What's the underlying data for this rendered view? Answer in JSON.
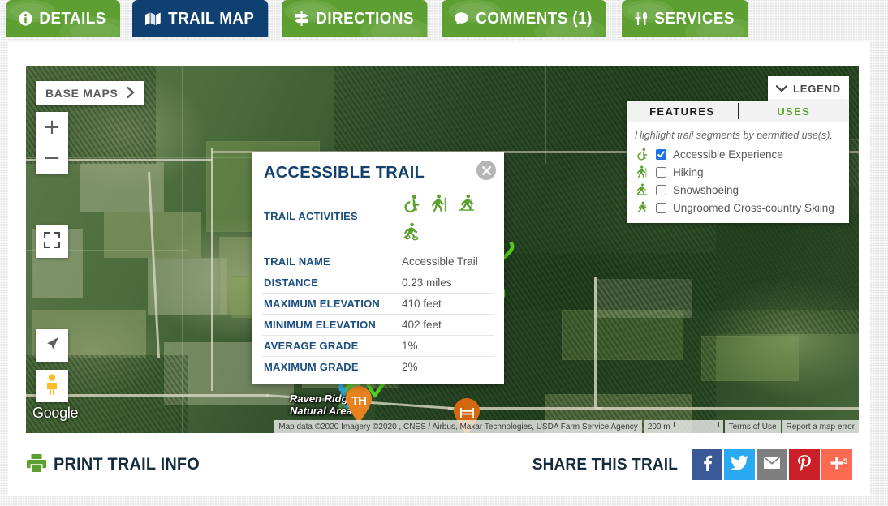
{
  "tabs": [
    {
      "label": "DETAILS",
      "icon": "info-icon",
      "active": false
    },
    {
      "label": "TRAIL MAP",
      "icon": "map-icon",
      "active": true
    },
    {
      "label": "DIRECTIONS",
      "icon": "signpost-icon",
      "active": false
    },
    {
      "label": "COMMENTS (1)",
      "icon": "comment-icon",
      "active": false
    },
    {
      "label": "SERVICES",
      "icon": "utensils-icon",
      "active": false
    }
  ],
  "map": {
    "base_maps_label": "BASE MAPS",
    "zoom_in_label": "+",
    "zoom_out_label": "−",
    "fullscreen_icon": "fullscreen-icon",
    "locate_icon": "navigation-arrow-icon",
    "pegman_icon": "street-view-pegman-icon",
    "google_logo": "Google",
    "place_label": "Raven Ridge\nNatural Area",
    "markers": [
      {
        "name": "trailhead-marker",
        "glyph": "TH",
        "color": "#e8821e"
      },
      {
        "name": "picnic-table-marker",
        "glyph": "picnic-table-icon",
        "color": "#8cc152"
      },
      {
        "name": "bench-marker",
        "glyph": "bench-icon",
        "color": "#d2690f"
      }
    ],
    "attribution": {
      "map_data": "Map data ©2020 Imagery ©2020 , CNES / Airbus, Maxar Technologies, USDA Farm Service Agency",
      "scale": "200 m",
      "terms": "Terms of Use",
      "report": "Report a map error"
    }
  },
  "info_popup": {
    "title": "ACCESSIBLE TRAIL",
    "close_icon": "close-icon",
    "activities_label": "TRAIL ACTIVITIES",
    "activities": [
      "wheelchair-accessible-icon",
      "hiking-icon",
      "cross-country-skiing-icon",
      "snowshoeing-icon"
    ],
    "rows": [
      {
        "key": "TRAIL NAME",
        "value": "Accessible Trail"
      },
      {
        "key": "DISTANCE",
        "value": "0.23 miles"
      },
      {
        "key": "MAXIMUM ELEVATION",
        "value": "410 feet"
      },
      {
        "key": "MINIMUM ELEVATION",
        "value": "402 feet"
      },
      {
        "key": "AVERAGE GRADE",
        "value": "1%"
      },
      {
        "key": "MAXIMUM GRADE",
        "value": "2%"
      }
    ]
  },
  "legend": {
    "header_label": "LEGEND",
    "chevron_icon": "chevron-down-icon",
    "tabs": [
      {
        "label": "FEATURES",
        "active": false
      },
      {
        "label": "USES",
        "active": true
      }
    ],
    "description": "Highlight trail segments by permitted use(s).",
    "items": [
      {
        "label": "Accessible Experience",
        "icon": "wheelchair-accessible-icon",
        "checked": true
      },
      {
        "label": "Hiking",
        "icon": "hiking-icon",
        "checked": false
      },
      {
        "label": "Snowshoeing",
        "icon": "snowshoeing-icon",
        "checked": false
      },
      {
        "label": "Ungroomed Cross-country Skiing",
        "icon": "cross-country-skiing-icon",
        "checked": false
      }
    ]
  },
  "bottom": {
    "print_label": "PRINT TRAIL INFO",
    "print_icon": "printer-icon",
    "share_label": "SHARE THIS TRAIL",
    "share_buttons": [
      {
        "name": "facebook",
        "glyph": "f",
        "color": "#3b5998",
        "count": ""
      },
      {
        "name": "twitter",
        "glyph": "twitter-bird-icon",
        "color": "#29a9f1",
        "count": ""
      },
      {
        "name": "email",
        "glyph": "envelope-icon",
        "color": "#7f7f7f",
        "count": ""
      },
      {
        "name": "pinterest",
        "glyph": "pinterest-icon",
        "color": "#cb2027",
        "count": ""
      },
      {
        "name": "more",
        "glyph": "plus-icon",
        "color": "#fb6a51",
        "count": "5"
      }
    ]
  },
  "colors": {
    "tab_green": "#5d9f31",
    "tab_active_navy": "#0e4071",
    "heading_blue": "#13406e",
    "accent_green": "#5d9f31",
    "trail_green": "#55cc22",
    "checkbox_blue": "#1a73e8"
  }
}
